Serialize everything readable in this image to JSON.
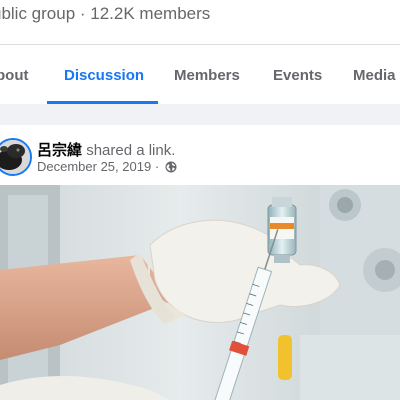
{
  "group": {
    "meta": "ublic group · 12.2K members"
  },
  "tabs": [
    {
      "label": "bout",
      "active": false
    },
    {
      "label": "Discussion",
      "active": true
    },
    {
      "label": "Members",
      "active": false
    },
    {
      "label": "Events",
      "active": false
    },
    {
      "label": "Media",
      "active": false
    }
  ],
  "post": {
    "author": "呂宗緯",
    "action": "shared a link.",
    "date": "December 25, 2019",
    "separator": "·",
    "privacy_icon": "globe-icon",
    "image_subject": "gloved hand drawing liquid from a vaccine vial with a syringe"
  },
  "colors": {
    "accent": "#1877f2",
    "secondary_text": "#65676b",
    "page_bg": "#f0f2f5",
    "card_bg": "#ffffff"
  }
}
